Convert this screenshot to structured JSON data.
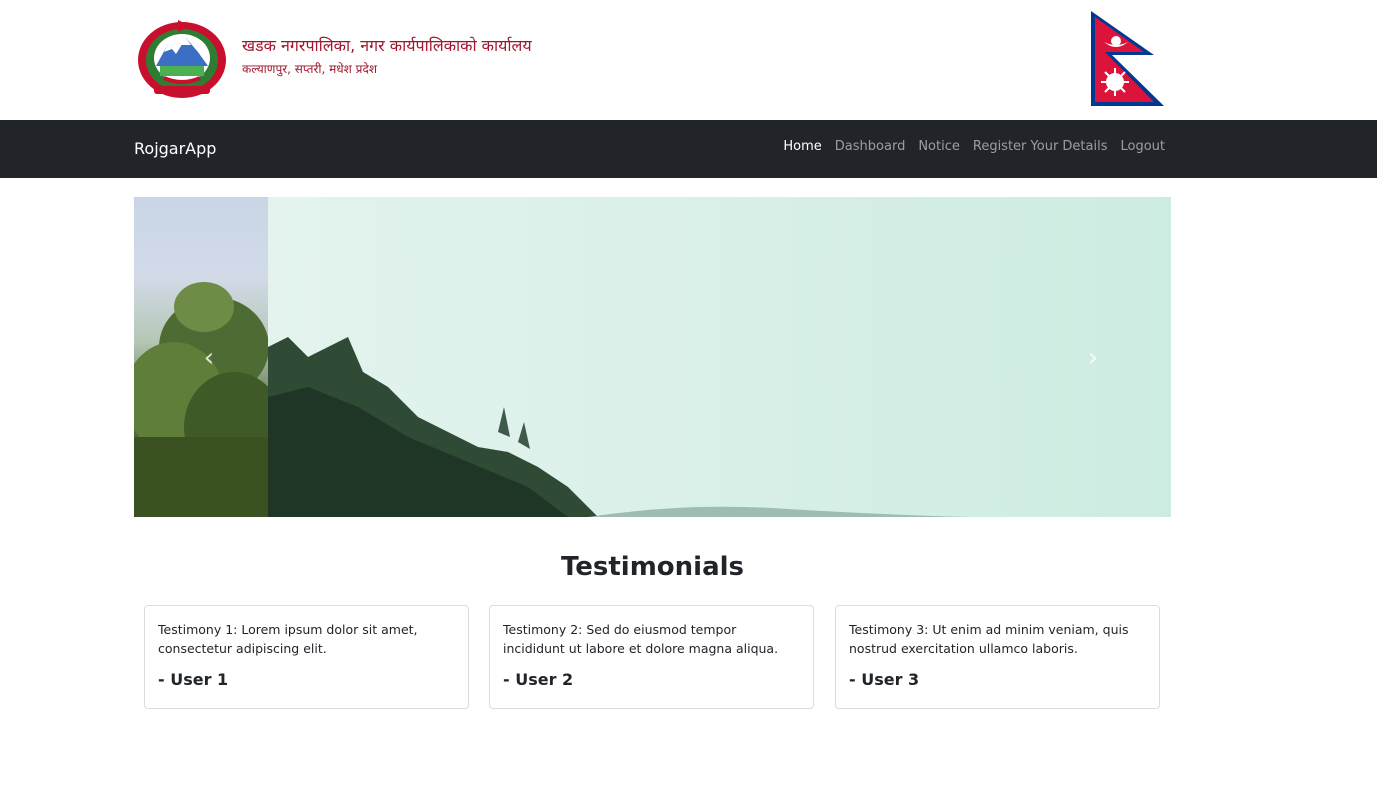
{
  "header": {
    "org_name": "खडक नगरपालिका, नगर कार्यपालिकाको कार्यालय",
    "org_address": "कल्याणपुर, सप्तरी, मधेश प्रदेश",
    "emblem_icon": "nepal-government-emblem-icon",
    "flag_icon": "nepal-flag-icon"
  },
  "navbar": {
    "brand": "RojgarApp",
    "links": [
      "Home",
      "Dashboard",
      "Notice",
      "Register Your Details",
      "Logout"
    ],
    "active": "Home"
  },
  "carousel": {
    "prev_icon": "chevron-left-icon",
    "next_icon": "chevron-right-icon"
  },
  "testimonials": {
    "title": "Testimonials",
    "items": [
      {
        "text": "Testimony 1: Lorem ipsum dolor sit amet, consectetur adipiscing elit.",
        "user": "- User 1"
      },
      {
        "text": "Testimony 2: Sed do eiusmod tempor incididunt ut labore et dolore magna aliqua.",
        "user": "- User 2"
      },
      {
        "text": "Testimony 3: Ut enim ad minim veniam, quis nostrud exercitation ullamco laboris.",
        "user": "- User 3"
      }
    ]
  },
  "colors": {
    "navbar_bg": "#212529",
    "header_text": "#a1162d",
    "flag_red": "#dc143c",
    "flag_blue": "#003893"
  }
}
